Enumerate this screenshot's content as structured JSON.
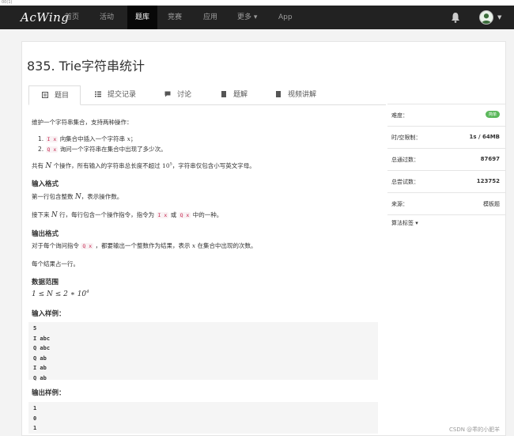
{
  "top_strip_text": "00(1)",
  "nav": {
    "logo": "AcWing",
    "items": [
      "首页",
      "活动",
      "题库",
      "竞赛",
      "应用",
      "更多 ▾",
      "App"
    ]
  },
  "problem": {
    "title": "835. Trie字符串统计",
    "tabs": [
      "题目",
      "提交记录",
      "讨论",
      "题解",
      "视频讲解"
    ],
    "intro": "维护一个字符串集合，支持两种操作：",
    "op1_num": "1.",
    "op1_code": "I x",
    "op1_text": "向集合中插入一个字符串",
    "op1_var": "x",
    "op1_end": "；",
    "op2_num": "2.",
    "op2_code": "Q x",
    "op2_text": "询问一个字符串在集合中出现了多少次。",
    "total_a": "共有",
    "total_var": "N",
    "total_b": "个操作，所有输入的字符串总长度不超过",
    "total_exp": "10",
    "total_sup": "5",
    "total_c": "，字符串仅包含小写英文字母。",
    "input_heading": "输入格式",
    "input_1a": "第一行包含整数",
    "input_1var": "N",
    "input_1b": "，表示操作数。",
    "input_2a": "接下来",
    "input_2var": "N",
    "input_2b": "行，每行包含一个操作指令，指令为",
    "input_2code1": "I x",
    "input_2c": "或",
    "input_2code2": "Q x",
    "input_2d": "中的一种。",
    "output_heading": "输出格式",
    "output_1a": "对于每个询问指令",
    "output_1code": "Q x",
    "output_1b": "，都要输出一个整数作为结果，表示",
    "output_1var": "x",
    "output_1c": "在集合中出现的次数。",
    "output_2": "每个结果占一行。",
    "range_heading": "数据范围",
    "range_expr": "1 ≤ N ≤ 2 ∗ 10",
    "range_sup": "4",
    "sample_in_heading": "输入样例：",
    "sample_in": [
      "5",
      "I abc",
      "Q abc",
      "Q ab",
      "I ab",
      "Q ab"
    ],
    "sample_out_heading": "输出样例：",
    "sample_out": [
      "1",
      "0",
      "1"
    ]
  },
  "sidebar": {
    "difficulty_label": "难度：",
    "difficulty_value": "简单",
    "limit_label": "时/空限制：",
    "limit_value": "1s / 64MB",
    "passed_label": "总通过数：",
    "passed_value": "87697",
    "tries_label": "总尝试数：",
    "tries_value": "123752",
    "source_label": "来源：",
    "source_value": "模板题",
    "tags_label": "算法标签 ▾"
  },
  "watermark": "CSDN @乖的小肥羊",
  "colors": {
    "navbar": "#222222",
    "code_text": "#c7254e",
    "badge": "#5cb85c"
  }
}
